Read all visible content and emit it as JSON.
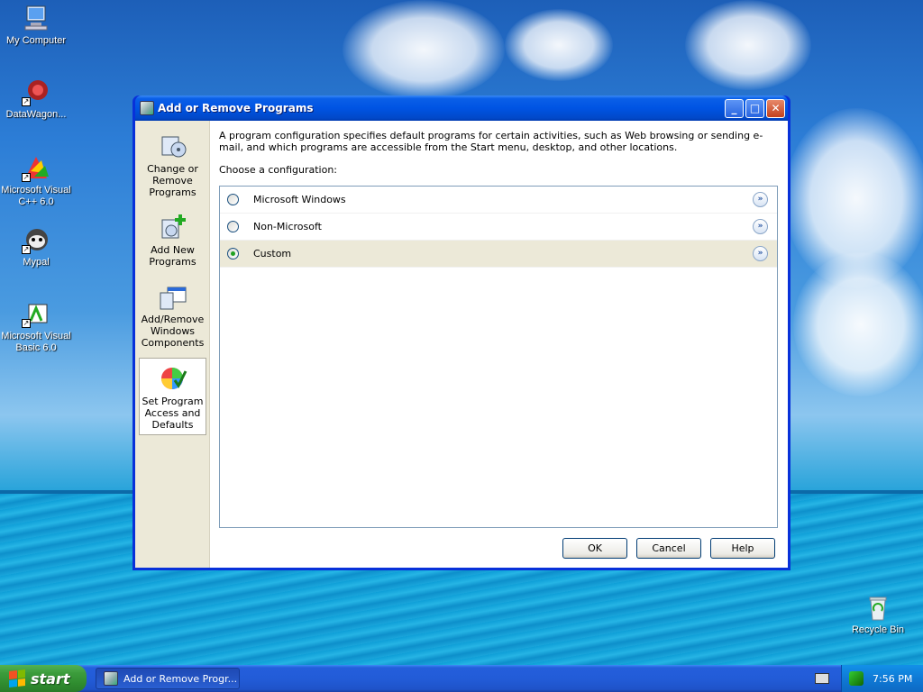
{
  "desktop": {
    "icons": [
      {
        "label": "My Computer",
        "icon": "computer-icon"
      },
      {
        "label": "DataWagon...",
        "icon": "datawagon-icon"
      },
      {
        "label": "Microsoft Visual C++ 6.0",
        "icon": "visual-cpp-icon"
      },
      {
        "label": "Mypal",
        "icon": "mypal-icon"
      },
      {
        "label": "Microsoft Visual Basic 6.0",
        "icon": "visual-basic-icon"
      },
      {
        "label": "Recycle Bin",
        "icon": "recycle-bin-icon"
      }
    ]
  },
  "window": {
    "title": "Add or Remove Programs",
    "controls": {
      "minimize": "_",
      "maximize": "□",
      "close": "✕"
    },
    "sidebar": [
      {
        "label": "Change or Remove Programs",
        "icon": "change-remove-icon"
      },
      {
        "label": "Add New Programs",
        "icon": "add-new-programs-icon"
      },
      {
        "label": "Add/Remove Windows Components",
        "icon": "windows-components-icon"
      },
      {
        "label": "Set Program Access and Defaults",
        "icon": "program-access-icon",
        "active": true
      }
    ],
    "description": "A program configuration specifies default programs for certain activities, such as Web browsing or sending e-mail, and which programs are accessible from the Start menu, desktop, and other locations.",
    "choose_label": "Choose a configuration:",
    "configurations": [
      {
        "label": "Microsoft Windows",
        "selected": false
      },
      {
        "label": "Non-Microsoft",
        "selected": false
      },
      {
        "label": "Custom",
        "selected": true
      }
    ],
    "buttons": {
      "ok": "OK",
      "cancel": "Cancel",
      "help": "Help"
    }
  },
  "taskbar": {
    "start_label": "start",
    "task_button": "Add or Remove Progr...",
    "clock": "7:56 PM"
  },
  "colors": {
    "titlebar": "#0054e3",
    "start_green": "#3c9c3c",
    "taskbar_blue": "#245edb",
    "selected_row": "#ece9d8"
  }
}
